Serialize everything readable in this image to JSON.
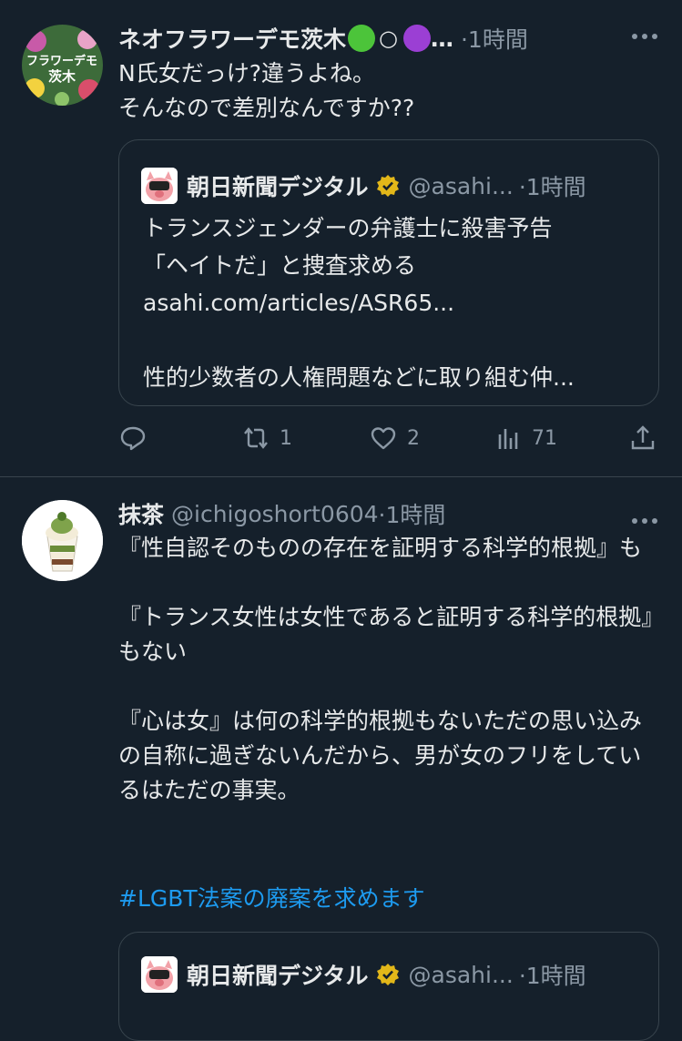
{
  "tweets": [
    {
      "author_name": "ネオフラワーデモ茨木",
      "author_suffix": "○",
      "ellipsis": "…",
      "time": "·1時間",
      "avatar_text": "フラワーデモ\n茨木",
      "text": "N氏女だっけ?違うよね。\nそんなので差別なんですか??",
      "quote": {
        "name": "朝日新聞デジタル",
        "handle": "@asahi...",
        "time": "·1時間",
        "text": "トランスジェンダーの弁護士に殺害予告\n「ヘイトだ」と捜査求める\nasahi.com/articles/ASR65...\n\n性的少数者の人権問題などに取り組む仲..."
      },
      "actions": {
        "reply": "",
        "retweet": "1",
        "like": "2",
        "views": "71"
      }
    },
    {
      "author_name": "抹茶",
      "handle": "@ichigoshort0604",
      "time": "·1時間",
      "text": "『性自認そのものの存在を証明する科学的根拠』も\n\n『トランス女性は女性であると証明する科学的根拠』もない\n\n『心は女』は何の科学的根拠もないただの思い込みの自称に過ぎないんだから、男が女のフリをしているはただの事実。",
      "hashtag": "#LGBT法案の廃案を求めます",
      "quote": {
        "name": "朝日新聞デジタル",
        "handle": "@asahi...",
        "time": "·1時間"
      }
    }
  ],
  "icons": {
    "more": "more-horizontal-icon",
    "reply": "reply-icon",
    "retweet": "retweet-icon",
    "like": "heart-icon",
    "views": "views-chart-icon",
    "share": "share-icon",
    "verified": "verified-gold-badge-icon"
  },
  "colors": {
    "background": "#15202b",
    "text": "#e7e9ea",
    "secondary": "#8b98a5",
    "link": "#1d9bf0",
    "border": "#38444d",
    "verified": "#e2b719"
  }
}
